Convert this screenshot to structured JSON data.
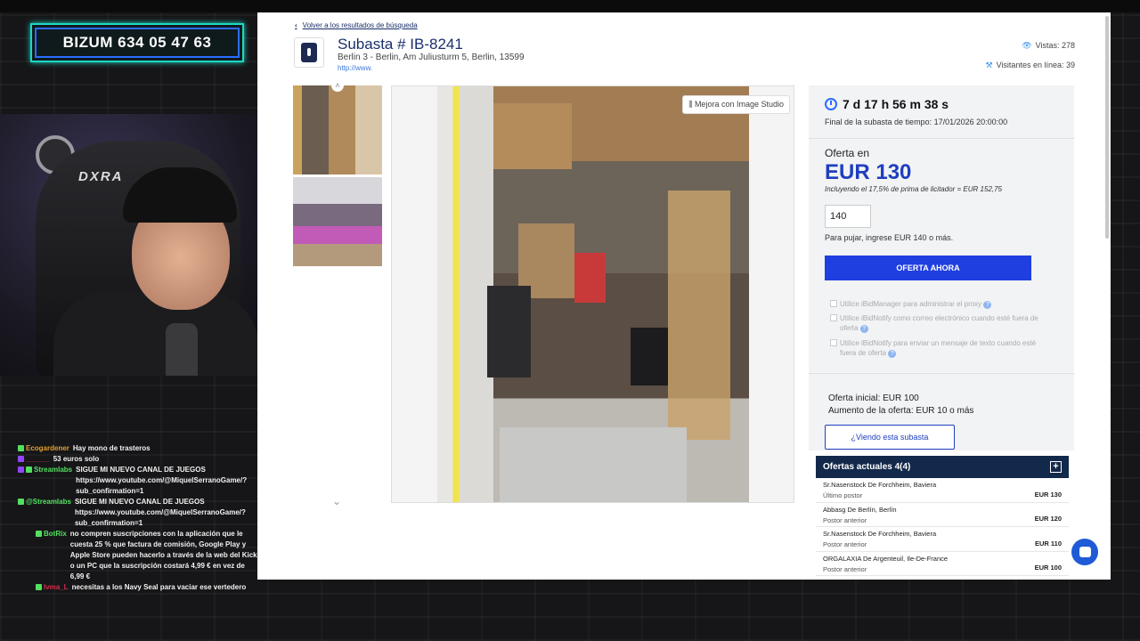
{
  "overlay": {
    "bizum_label": "BIZUM 634 05 47 63",
    "webcam_chair_brand": "DXRA"
  },
  "chat": [
    {
      "user": "Ecogardener",
      "user_color": "#e0a030",
      "message": "Hay mono de trasteros"
    },
    {
      "user": "______",
      "user_color": "#d0304a",
      "message": "53 euros solo"
    },
    {
      "user": "Streamlabs",
      "user_color": "#52e060",
      "message": "SIGUE MI NUEVO CANAL DE JUEGOS https://www.youtube.com/@MiquelSerranoGame/?sub_confirmation=1"
    },
    {
      "user": "@Streamlabs",
      "user_color": "#52e060",
      "message": "SIGUE MI NUEVO CANAL DE JUEGOS https://www.youtube.com/@MiquelSerranoGame/?sub_confirmation=1"
    },
    {
      "user": "BotRix",
      "user_color": "#52e060",
      "message": "no compren suscripciones con la aplicación que le cuesta 25 % que factura de comisión, Google Play y Apple Store pueden hacerlo a través de la web del Kick o un PC que la suscripción costará 4,99 € en vez de 6,99 €"
    },
    {
      "user": "Ivma_L",
      "user_color": "#d0304a",
      "message": "necesitas a los Navy Seal para vaciar ese vertedero"
    }
  ],
  "page": {
    "back_link": "Volver a los resultados de búsqueda",
    "title": "Subasta # IB-8241",
    "address": "Berlin 3 - Berlin, Am Juliusturm 5, Berlin, 13599",
    "url": "http://www.",
    "views": "Vistas: 278",
    "online": "Visitantes en línea: 39",
    "enhance_button": "Mejora con Image Studio"
  },
  "bidding": {
    "timer": "7 d 17 h 56 m 38 s",
    "end_label": "Final de la subasta de tiempo: 17/01/2026 20:00:00",
    "offer_label": "Oferta en",
    "offer_value": "EUR 130",
    "premium": "Incluyendo el 17,5% de prima de licitador = EUR 152,75",
    "input_value": "140",
    "hint": "Para pujar, ingrese EUR 140 o más.",
    "bid_button": "OFERTA AHORA",
    "opt1": "Utilice iBidManager para administrar el proxy",
    "opt2": "Utilice iBidNotify como correo electrónico cuando esté fuera de oferta",
    "opt3": "Utilice iBidNotify para enviar un mensaje de texto cuando esté fuera de oferta",
    "initial_offer": "Oferta inicial: EUR 100",
    "increment": "Aumento de la oferta: EUR 10 o más",
    "watch_button": "¿Viendo esta subasta"
  },
  "offers": {
    "header": "Ofertas actuales 4(4)",
    "rows": [
      {
        "name": "Sr.Nasenstock De Forchheim, Baviera",
        "role": "Último postor",
        "amount": "EUR 130"
      },
      {
        "name": "Abbasg De Berlín, Berlín",
        "role": "Postor anterior",
        "amount": "EUR 120"
      },
      {
        "name": "Sr.Nasenstock De Forchheim, Baviera",
        "role": "Postor anterior",
        "amount": "EUR 110"
      },
      {
        "name": "ORGALAXIA De Argenteuil, Ile-De-France",
        "role": "Postor anterior",
        "amount": "EUR 100"
      }
    ]
  }
}
